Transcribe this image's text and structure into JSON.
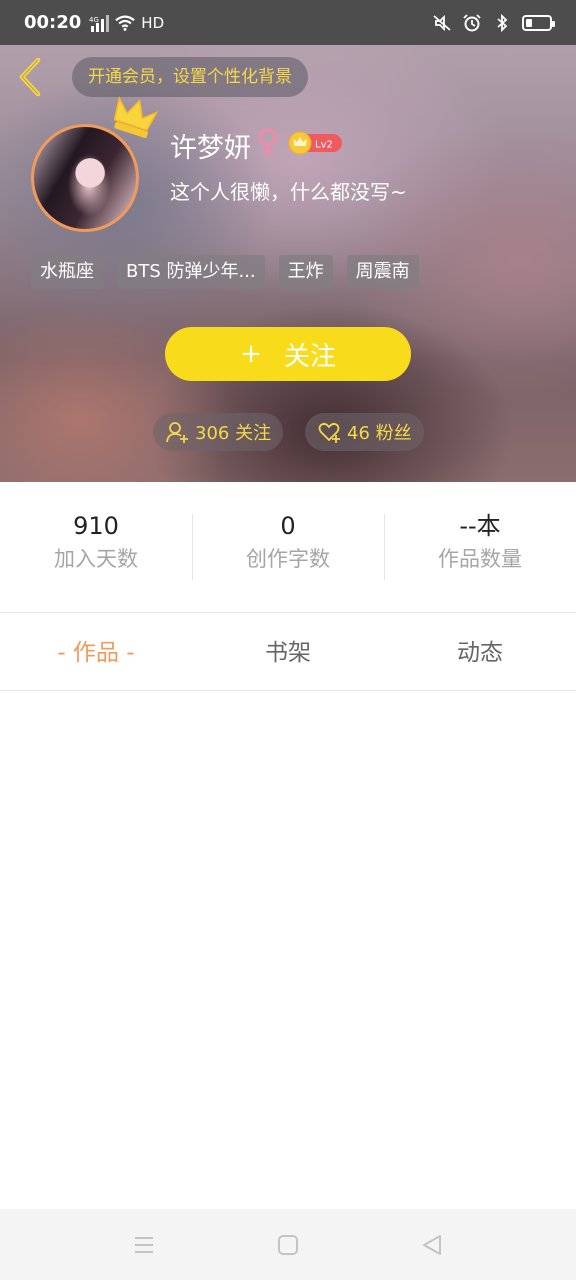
{
  "status_bar": {
    "time": "00:20",
    "network": "4G",
    "wifi_label": "HD"
  },
  "header": {
    "vip_banner": "开通会员，设置个性化背景",
    "name": "许梦妍",
    "gender_symbol": "♀",
    "level": "Lv2",
    "bio": "这个人很懒，什么都没写~",
    "tags": [
      "水瓶座",
      "BTS  防弹少年...",
      "王炸",
      "周震南"
    ],
    "follow_button": {
      "plus": "+",
      "label": "关注"
    },
    "following": "306 关注",
    "fans": "46 粉丝"
  },
  "stats": [
    {
      "value": "910",
      "label": "加入天数"
    },
    {
      "value": "0",
      "label": "创作字数"
    },
    {
      "value": "--本",
      "label": "作品数量"
    }
  ],
  "tabs": [
    {
      "label": "- 作品 -",
      "active": true
    },
    {
      "label": "书架",
      "active": false
    },
    {
      "label": "动态",
      "active": false
    }
  ],
  "colors": {
    "accent": "#f09a5c",
    "follow_yellow": "#f8dc1c",
    "vip_text": "#f7d846",
    "gender_pink": "#f08aa8"
  }
}
